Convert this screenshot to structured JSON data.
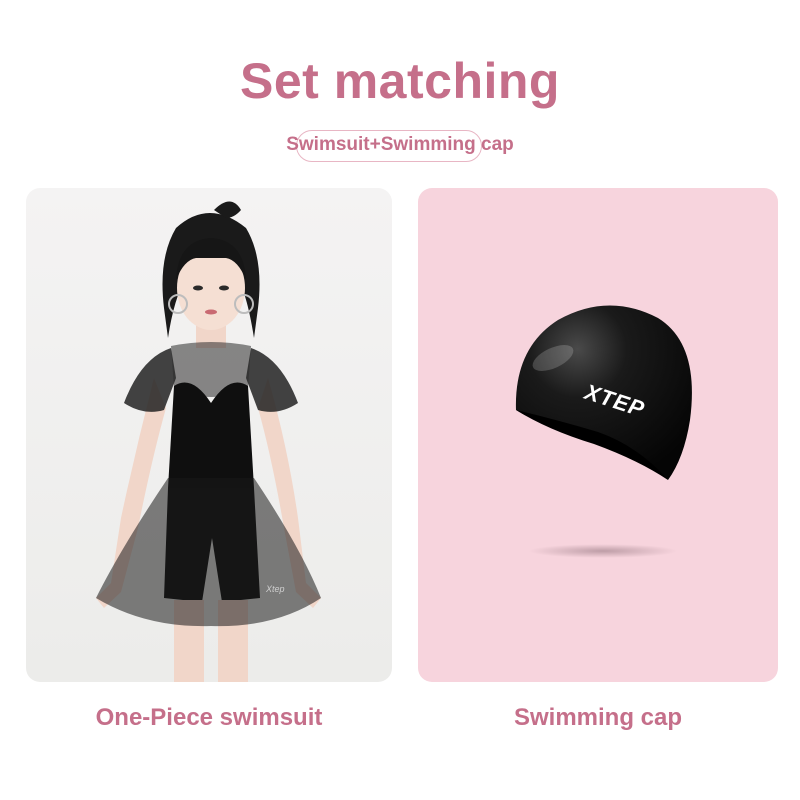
{
  "header": {
    "title": "Set matching",
    "subtitle": "Swimsuit+Swimming cap"
  },
  "products": [
    {
      "caption": "One-Piece swimsuit",
      "image": "woman-in-black-mesh-swimsuit"
    },
    {
      "caption": "Swimming cap",
      "image": "black-silicone-swim-cap",
      "logo_text": "XTEP"
    }
  ],
  "colors": {
    "accent": "#c56f8a",
    "pink_panel": "#f7d4dd",
    "grey_panel": "#efeeed"
  }
}
